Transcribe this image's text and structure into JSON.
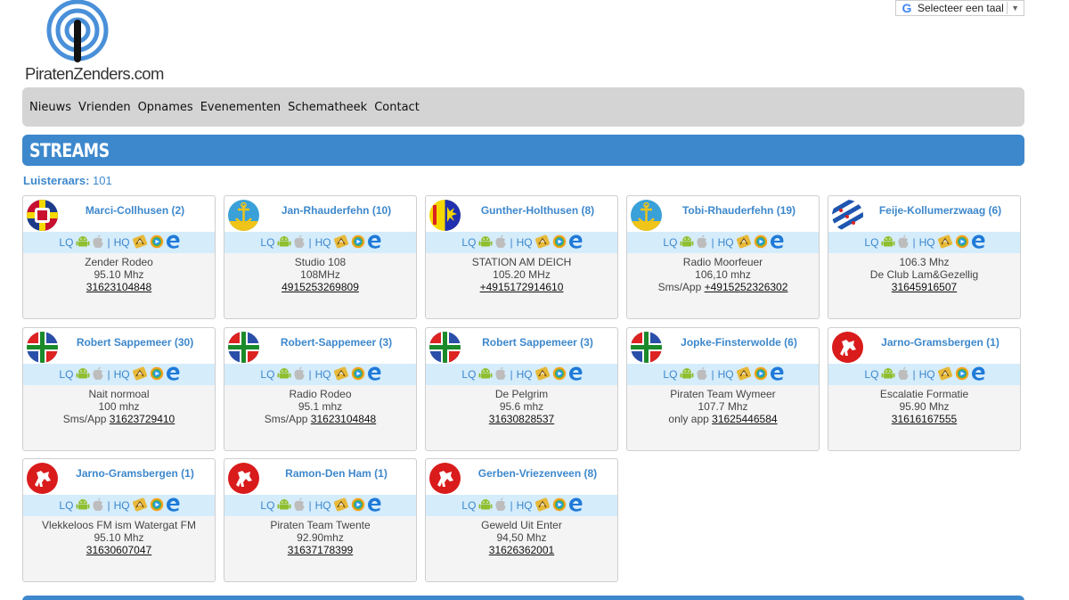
{
  "translate": {
    "label": "Selecteer een taal"
  },
  "logo": {
    "text": "PiratenZenders.com"
  },
  "nav": [
    "Nieuws",
    "Vrienden",
    "Opnames",
    "Evenementen",
    "Schematheek",
    "Contact"
  ],
  "section": {
    "title": "STREAMS"
  },
  "listeners": {
    "label": "Luisteraars:",
    "count": "101"
  },
  "stream_links": {
    "lq": "LQ",
    "hq": "HQ",
    "sep": "|"
  },
  "streams": [
    {
      "name": "Marci-Collhusen (2)",
      "flag": "multi-flag",
      "lines": [
        "Zender Rodeo",
        "95.10 Mhz"
      ],
      "prefix": "",
      "number": "31623104848"
    },
    {
      "name": "Jan-Rhauderfehn (10)",
      "flag": "anchor-flag",
      "lines": [
        "Studio 108",
        "108MHz"
      ],
      "prefix": "",
      "number": "4915253269809"
    },
    {
      "name": "Gunther-Holthusen (8)",
      "flag": "yellow-blue-flag",
      "lines": [
        "STATION AM DEICH",
        "105.20 MHz"
      ],
      "prefix": "",
      "number": "+4915172914610"
    },
    {
      "name": "Tobi-Rhauderfehn (19)",
      "flag": "anchor-flag",
      "lines": [
        "Radio Moorfeuer",
        "106,10 mhz"
      ],
      "prefix": "Sms/App",
      "number": "+4915252326302"
    },
    {
      "name": "Feije-Kollumerzwaag (6)",
      "flag": "friesland-flag",
      "lines": [
        "106.3 Mhz",
        "De Club Lam&Gezellig"
      ],
      "prefix": "",
      "number": "31645916507"
    },
    {
      "name": "Robert Sappemeer (30)",
      "flag": "groningen-flag",
      "lines": [
        "Nait normoal",
        "100 mhz"
      ],
      "prefix": "Sms/App",
      "number": "31623729410"
    },
    {
      "name": "Robert-Sappemeer (3)",
      "flag": "groningen-flag",
      "lines": [
        "Radio Rodeo",
        "95.1 mhz"
      ],
      "prefix": "Sms/App",
      "number": "31623104848"
    },
    {
      "name": "Robert Sappemeer (3)",
      "flag": "groningen-flag",
      "lines": [
        "De Pelgrim",
        "95.6 mhz"
      ],
      "prefix": "",
      "number": "31630828537"
    },
    {
      "name": "Jopke-Finsterwolde (6)",
      "flag": "groningen-flag",
      "lines": [
        "Piraten Team Wymeer",
        "107.7 Mhz"
      ],
      "prefix": "only app",
      "number": "31625446584"
    },
    {
      "name": "Jarno-Gramsbergen (1)",
      "flag": "twente-flag",
      "lines": [
        "Escalatie Formatie",
        "95.90 Mhz"
      ],
      "prefix": "",
      "number": "31616167555"
    },
    {
      "name": "Jarno-Gramsbergen (1)",
      "flag": "twente-flag",
      "lines": [
        "Vlekkeloos FM ism Watergat FM",
        "95.10 Mhz"
      ],
      "prefix": "",
      "number": "31630607047"
    },
    {
      "name": "Ramon-Den Ham (1)",
      "flag": "twente-flag",
      "lines": [
        "Piraten Team Twente",
        "92.90mhz"
      ],
      "prefix": "",
      "number": "31637178399"
    },
    {
      "name": "Gerben-Vriezenveen (8)",
      "flag": "twente-flag",
      "lines": [
        "Geweld Uit Enter",
        "94,50 Mhz"
      ],
      "prefix": "",
      "number": "31626362001"
    }
  ],
  "colors": {
    "accent": "#3d88cc",
    "nav_bg": "#d4d4d4",
    "links_bg": "#d5ecfb",
    "card_bg": "#f4f4f4"
  }
}
